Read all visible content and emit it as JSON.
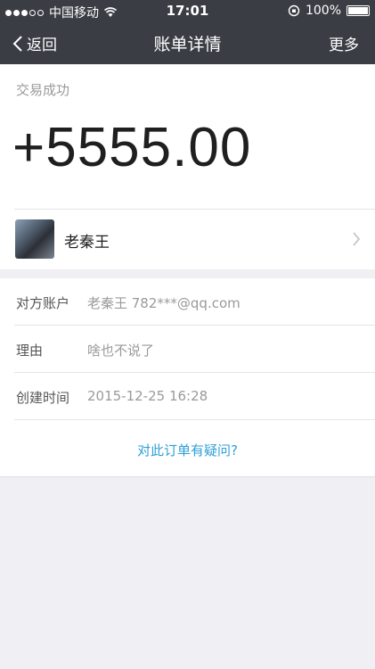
{
  "status_bar": {
    "carrier": "中国移动",
    "time": "17:01",
    "battery": "100%"
  },
  "nav": {
    "back_label": "返回",
    "title": "账单详情",
    "more_label": "更多"
  },
  "transaction": {
    "status": "交易成功",
    "amount": "+5555.00"
  },
  "counterparty": {
    "name": "老秦王"
  },
  "details": [
    {
      "label": "对方账户",
      "value": "老秦王 782***@qq.com"
    },
    {
      "label": "理由",
      "value": "啥也不说了"
    },
    {
      "label": "创建时间",
      "value": "2015-12-25 16:28"
    }
  ],
  "question_link": "对此订单有疑问?",
  "colors": {
    "header_bg": "#3a3d44",
    "link": "#2f9fd8",
    "page_bg": "#efeff4"
  }
}
